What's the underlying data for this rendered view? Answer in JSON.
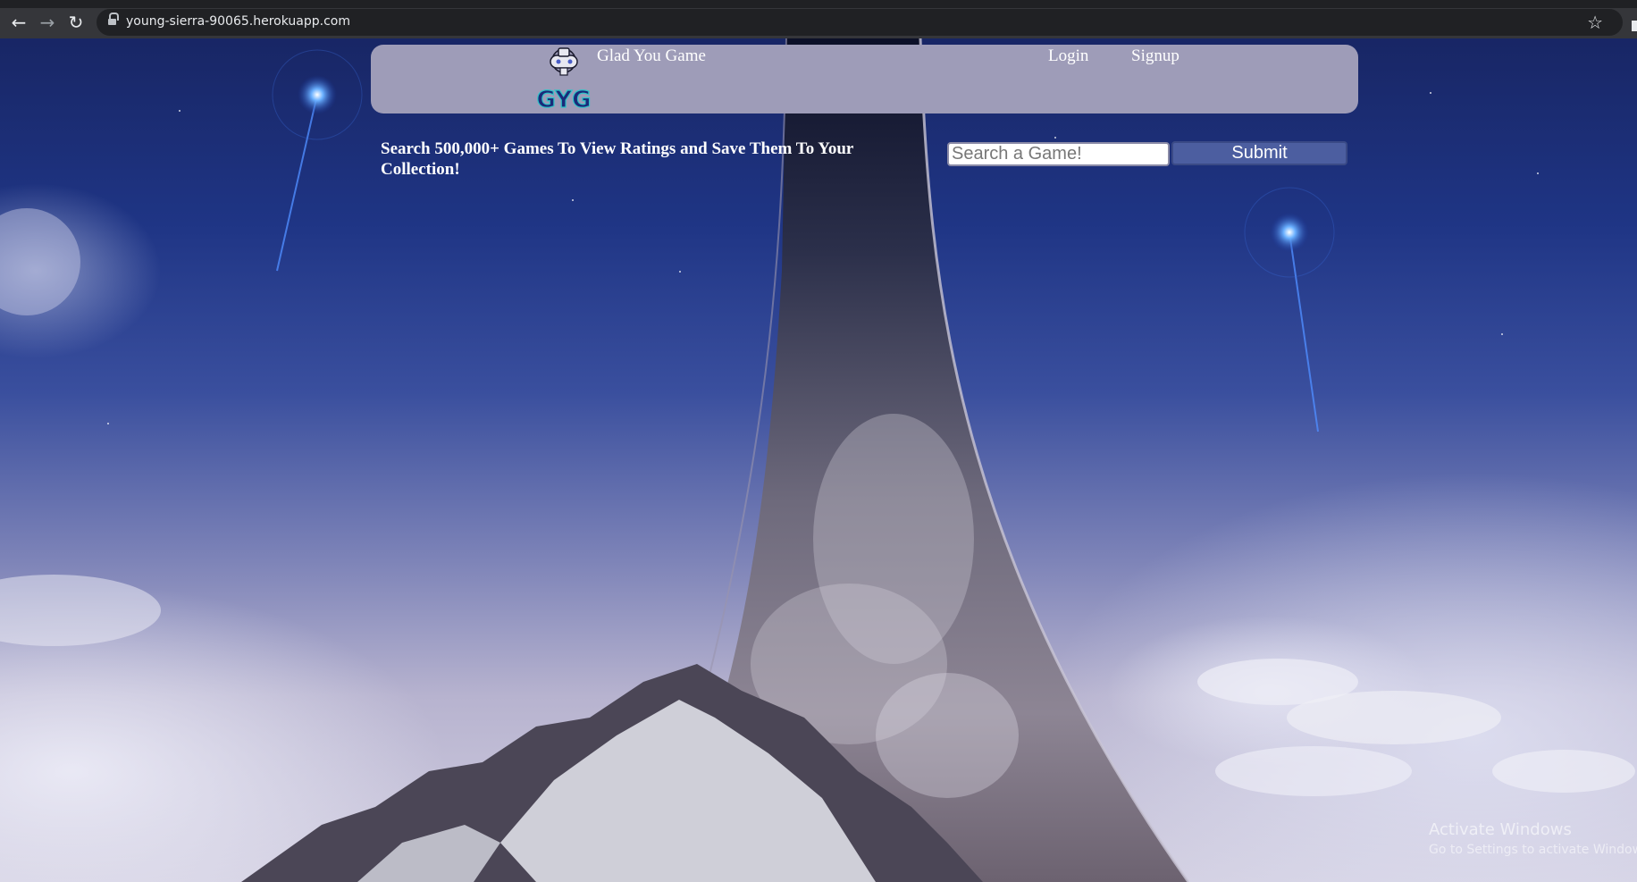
{
  "browser": {
    "url": "young-sierra-90065.herokuapp.com",
    "icons": [
      "back-arrow-icon",
      "forward-arrow-icon",
      "reload-icon",
      "lock-icon",
      "bookmark-star-icon"
    ]
  },
  "header": {
    "logo_text": "GYG",
    "brand": "Glad You Game",
    "nav": {
      "login": "Login",
      "signup": "Signup"
    }
  },
  "search": {
    "tagline": "Search 500,000+ Games To View Ratings and Save Them To Your Collection!",
    "placeholder": "Search a Game!",
    "submit_label": "Submit"
  },
  "watermark": {
    "title": "Activate Windows",
    "subtitle": "Go to Settings to activate Windows."
  },
  "colors": {
    "header_bg": "#9e9cb8",
    "button_bg": "#4c5ea0",
    "sky_top": "#182665",
    "sky_bottom": "#d2cfe1"
  }
}
